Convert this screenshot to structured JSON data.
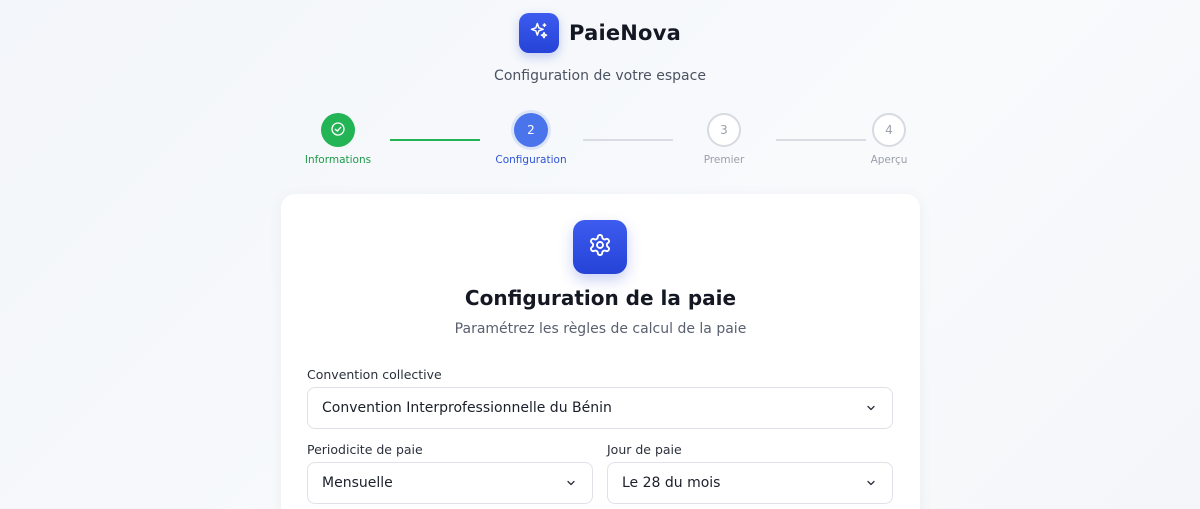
{
  "brand": {
    "name": "PaieNova",
    "logo_icon": "sparkles-icon",
    "color": "#2f4de0"
  },
  "subtitle": "Configuration de votre espace",
  "stepper": {
    "steps": [
      {
        "number": "1",
        "label": "Informations",
        "status": "done",
        "icon": "check-circle-icon"
      },
      {
        "number": "2",
        "label": "Configuration",
        "status": "active"
      },
      {
        "number": "3",
        "label": "Premier",
        "status": "todo"
      },
      {
        "number": "4",
        "label": "Aperçu",
        "status": "todo"
      }
    ],
    "colors": {
      "done": "#22b455",
      "active": "#4a74ec",
      "todo": "#d6dae1"
    }
  },
  "card": {
    "icon": "gear-icon",
    "title": "Configuration de la paie",
    "subtitle": "Paramétrez les règles de calcul de la paie",
    "fields": {
      "convention": {
        "label": "Convention collective",
        "value": "Convention Interprofessionnelle du Bénin"
      },
      "periodicite": {
        "label": "Periodicite de paie",
        "value": "Mensuelle"
      },
      "jour": {
        "label": "Jour de paie",
        "value": "Le 28 du mois"
      }
    }
  }
}
